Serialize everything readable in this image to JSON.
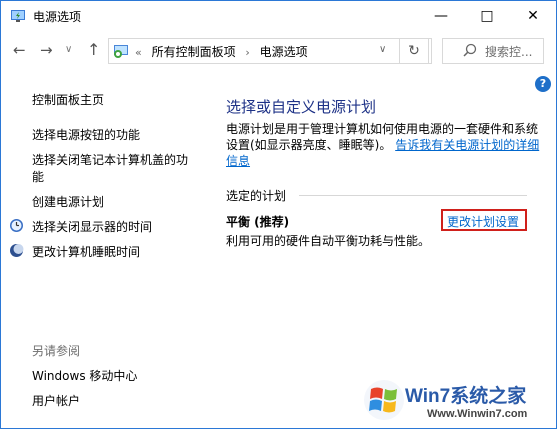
{
  "window": {
    "title": "电源选项"
  },
  "nav": {
    "address_items": [
      "所有控制面板项",
      "电源选项"
    ],
    "overflow": "«",
    "search_placeholder": "搜索控..."
  },
  "left_pane": {
    "home": "控制面板主页",
    "links": [
      "选择电源按钮的功能",
      "选择关闭笔记本计算机盖的功",
      "能",
      "创建电源计划",
      "选择关闭显示器的时间",
      "更改计算机睡眠时间"
    ],
    "see_also_label": "另请参阅",
    "see_also": [
      "Windows 移动中心",
      "用户帐户"
    ]
  },
  "main": {
    "title": "选择或自定义电源计划",
    "description_line1": "电源计划是用于管理计算机如何使用电源的一套硬件和系统",
    "description_line2": "设置(如显示器亮度、睡眠等)。",
    "description_link_a": "告诉我有关电源计划的详细",
    "description_link_b": "信息",
    "section_label": "选定的计划",
    "plan_name": "平衡 (推荐)",
    "plan_desc": "利用可用的硬件自动平衡功耗与性能。",
    "change_link": "更改计划设置"
  },
  "watermark": {
    "brand": "Win7系统之家",
    "url": "Www.Winwin7.com"
  },
  "colors": {
    "accent": "#1e6fc9",
    "link": "#0066cc",
    "title": "#1e3287",
    "highlight": "#d0201b"
  }
}
